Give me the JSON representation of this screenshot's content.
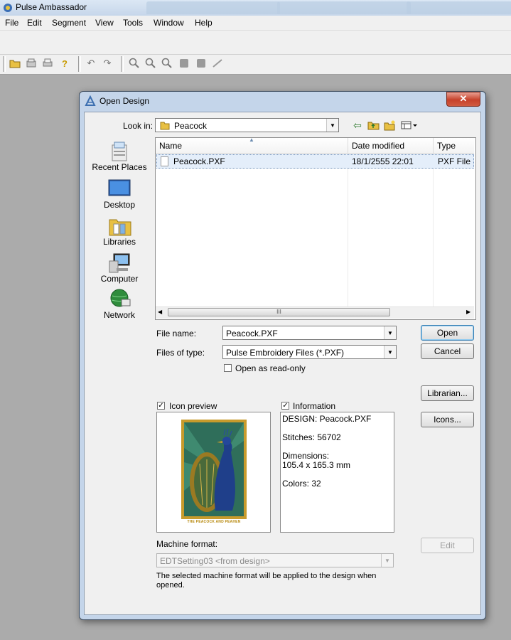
{
  "app": {
    "title": "Pulse Ambassador",
    "background_tabs": [
      "",
      "",
      "",
      ""
    ]
  },
  "menu": [
    "File",
    "Edit",
    "Segment",
    "View",
    "Tools",
    "Window",
    "Help"
  ],
  "dialog": {
    "title": "Open Design",
    "close_label": "✕",
    "look_in_label": "Look in:",
    "look_in_value": "Peacock",
    "places": [
      "Recent Places",
      "Desktop",
      "Libraries",
      "Computer",
      "Network"
    ],
    "columns": [
      "Name",
      "Date modified",
      "Type"
    ],
    "files": [
      {
        "name": "Peacock.PXF",
        "date": "18/1/2555 22:01",
        "type": "PXF File"
      }
    ],
    "scroll_grip": "III",
    "file_name_label": "File name:",
    "file_name_value": "Peacock.PXF",
    "file_type_label": "Files of type:",
    "file_type_value": "Pulse Embroidery Files (*.PXF)",
    "read_only_label": "Open as read-only",
    "open_button": "Open",
    "cancel_button": "Cancel",
    "librarian_button": "Librarian...",
    "icons_button": "Icons...",
    "edit_button": "Edit",
    "icon_preview_label": "Icon preview",
    "information_label": "Information",
    "preview_caption": "THE PEACOCK AND PEAHEN",
    "info": {
      "design": "DESIGN:   Peacock.PXF",
      "stitches": "Stitches:   56702",
      "dimensions_label": "Dimensions:",
      "dimensions_value": "105.4 x 165.3 mm",
      "colors": "Colors:   32"
    },
    "machine_format_label": "Machine format:",
    "machine_format_value": "EDTSetting03 <from design>",
    "machine_note": "The selected machine format will be applied to the design when opened."
  },
  "colors": {
    "accent": "#3c7fb1",
    "title_bar": "#c4d5ea",
    "close": "#c6412b",
    "selection": "#e4eefa"
  }
}
